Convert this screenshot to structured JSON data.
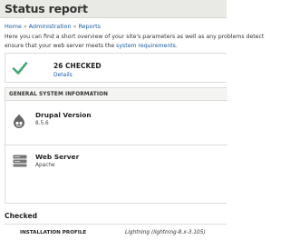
{
  "header": {
    "title": "Status report",
    "star_icon": "star-icon"
  },
  "breadcrumb": [
    "Home",
    "Administration",
    "Reports"
  ],
  "intro": {
    "line1": "Here you can find a short overview of your site's parameters as well as any problems detect",
    "line2_prefix": "ensure that your web server meets the ",
    "line2_link": "system requirements",
    "line2_suffix": "."
  },
  "summary": {
    "icon": "checkmark-icon",
    "count_label": "26 CHECKED",
    "details_label": "Details",
    "accent": "#42a877"
  },
  "general_info": {
    "title": "GENERAL SYSTEM INFORMATION",
    "items": [
      {
        "icon": "drupal-drop-icon",
        "title": "Drupal Version",
        "value": "8.5.6"
      },
      {
        "icon": "web-server-icon",
        "title": "Web Server",
        "value": "Apache"
      }
    ]
  },
  "checked_section": {
    "heading": "Checked",
    "rows": [
      {
        "label": "INSTALLATION PROFILE",
        "value": "Lightning (lightning-8.x-3.105)"
      }
    ]
  }
}
